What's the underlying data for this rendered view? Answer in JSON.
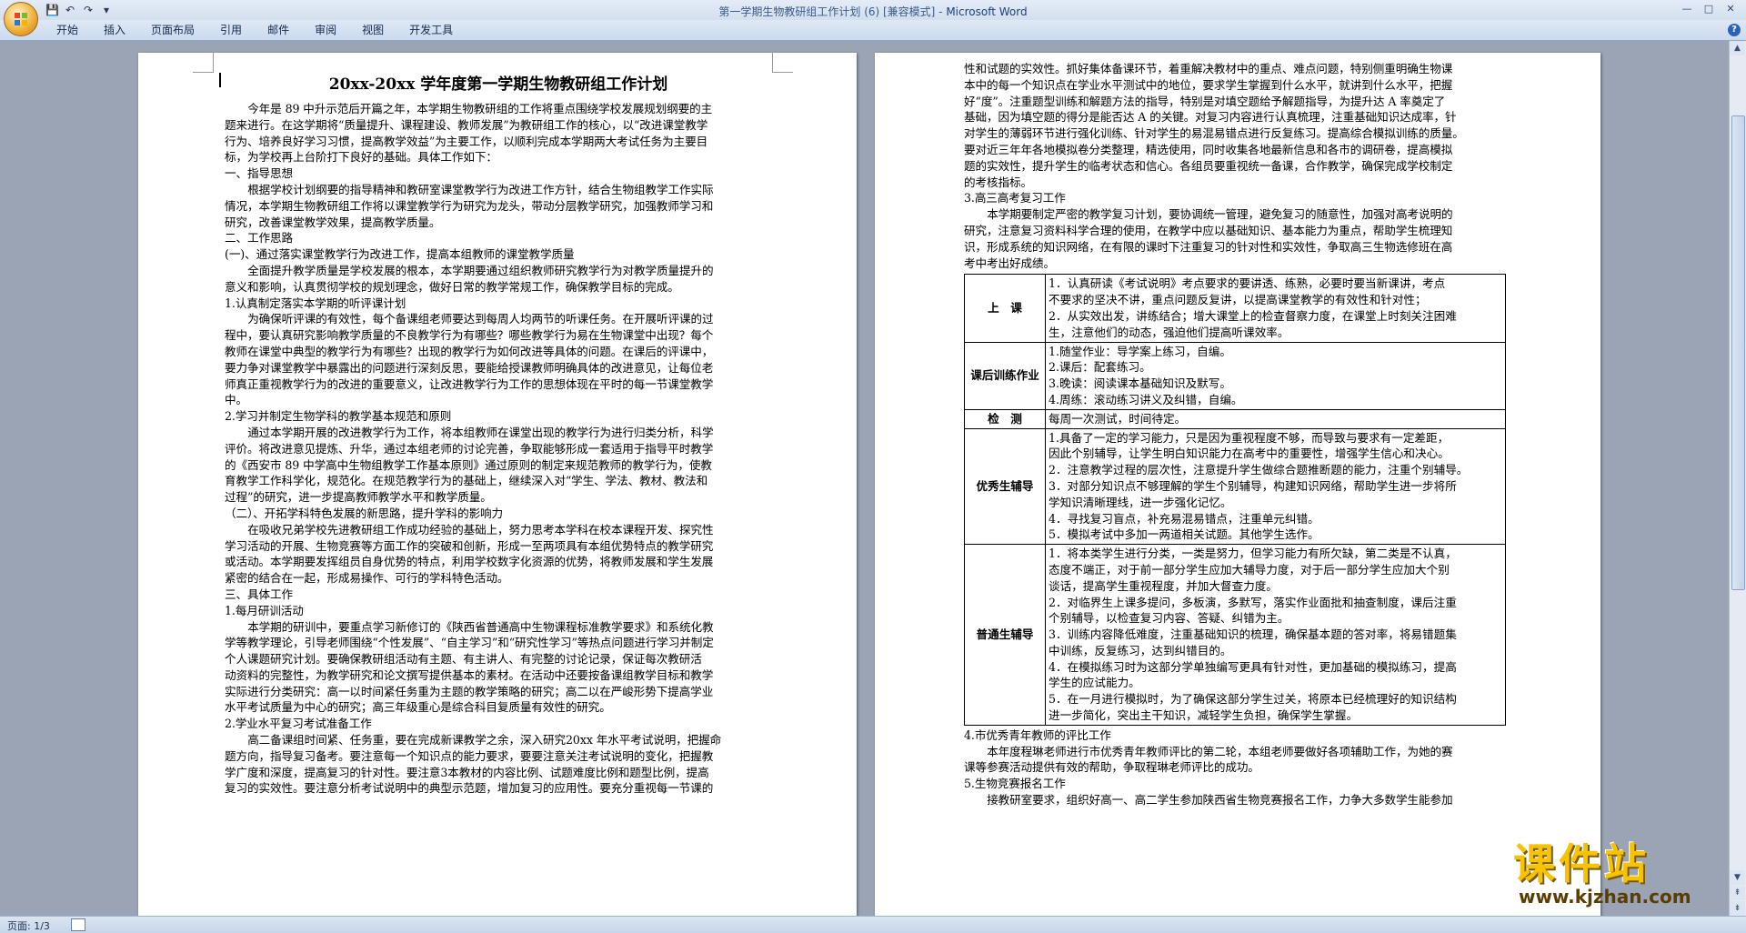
{
  "window": {
    "title": "第一学期生物教研组工作计划 (6) [兼容模式] - ",
    "app_name": "Microsoft Word",
    "controls": [
      "—",
      "□",
      "✕"
    ]
  },
  "quick_access": {
    "save": "💾",
    "undo": "↶",
    "redo": "↷",
    "more": "▾"
  },
  "ribbon": {
    "tabs": [
      "开始",
      "插入",
      "页面布局",
      "引用",
      "邮件",
      "审阅",
      "视图",
      "开发工具"
    ],
    "help": "?"
  },
  "status": {
    "page_indicator": "页面: 1/3"
  },
  "watermark": {
    "text": "课件站",
    "url": "www.kjzhan.com"
  },
  "page1": {
    "title": "20xx-20xx 学年度第一学期生物教研组工作计划",
    "lines": [
      "今年是 89 中升示范后开篇之年，本学期生物教研组的工作将重点围绕学校发展规划纲要的主",
      "题来进行。在这学期将“质量提升、课程建设、教师发展”为教研组工作的核心，以“改进课堂教学",
      "行为、培养良好学习习惯，提高教学效益”为主要工作，以顺利完成本学期两大考试任务为主要目",
      "标，为学校再上台阶打下良好的基础。具体工作如下：",
      "一、指导思想",
      "根据学校计划纲要的指导精神和教研室课堂教学行为改进工作方针，结合生物组教学工作实际",
      "情况，本学期生物教研组工作将以课堂教学行为研究为龙头，带动分层教学研究，加强教师学习和",
      "研究，改善课堂教学效果，提高教学质量。",
      "二、工作思路",
      "(一)、通过落实课堂教学行为改进工作，提高本组教师的课堂教学质量",
      "全面提升教学质量是学校发展的根本，本学期要通过组织教师研究教学行为对教学质量提升的",
      "意义和影响，认真贯彻学校的规划理念，做好日常的教学常规工作，确保教学目标的完成。",
      "1.认真制定落实本学期的听评课计划",
      "为确保听评课的有效性，每个备课组老师要达到每周人均两节的听课任务。在开展听评课的过",
      "程中，要认真研究影响教学质量的不良教学行为有哪些？哪些教学行为易在生物课堂中出现？每个",
      "教师在课堂中典型的教学行为有哪些？出现的教学行为如何改进等具体的问题。在课后的评课中，",
      "要力争对课堂教学中暴露出的问题进行深刻反思，要能给授课教师明确具体的改进意见，让每位老",
      "师真正重视教学行为的改进的重要意义，让改进教学行为工作的思想体现在平时的每一节课堂教学",
      "中。",
      "2.学习并制定生物学科的教学基本规范和原则",
      "通过本学期开展的改进教学行为工作，将本组教师在课堂出现的教学行为进行归类分析，科学",
      "评价。将改进意见提炼、升华，通过本组老师的讨论完善，争取能够形成一套适用于指导平时教学",
      "的《西安市 89 中学高中生物组教学工作基本原则》通过原则的制定来规范教师的教学行为，使教",
      "育教学工作科学化，规范化。在规范教学行为的基础上，继续深入对“学生、学法、教材、教法和",
      "过程”的研究，进一步提高教师教学水平和教学质量。",
      "（二）、开拓学科特色发展的新思路，提升学科的影响力",
      "在吸收兄弟学校先进教研组工作成功经验的基础上，努力思考本学科在校本课程开发、探究性",
      "学习活动的开展、生物竞赛等方面工作的突破和创新，形成一至两项具有本组优势特点的教学研究",
      "或活动。本学期要发挥组员自身优势的特点，利用学校数字化资源的优势，将教师发展和学生发展",
      "紧密的结合在一起，形成易操作、可行的学科特色活动。",
      "三、具体工作",
      "1.每月研训活动",
      "本学期的研训中，要重点学习新修订的《陕西省普通高中生物课程标准教学要求》和系统化教",
      "学等教学理论，引导老师围绕“个性发展”、“自主学习”和“研究性学习”等热点问题进行学习并制定",
      "个人课题研究计划。要确保教研组活动有主题、有主讲人、有完整的讨论记录，保证每次教研活",
      "动资料的完整性，为教学研究和论文撰写提供基本的素材。在活动中还要按备课组教学目标和教学",
      "实际进行分类研究：高一以时间紧任务重为主题的教学策略的研究；高二以在严峻形势下提高学业",
      "水平考试质量为中心的研究；高三年级重心是综合科目复质量有效性的研究。",
      "2.学业水平复习考试准备工作",
      "高二备课组时间紧、任务重，要在完成新课教学之余，深入研究20xx 年水平考试说明，把握命",
      "题方向，指导复习备考。要注意每一个知识点的能力要求，要要注意关注考试说明的变化，把握教",
      "学广度和深度，提高复习的针对性。要注意3本教材的内容比例、试题难度比例和题型比例，提高",
      "复习的实效性。要注意分析考试说明中的典型示范题，增加复习的应用性。要充分重视每一节课的"
    ]
  },
  "page2": {
    "lines_top": [
      "性和试题的实效性。抓好集体备课环节，着重解决教材中的重点、难点问题，特别侧重明确生物课",
      "本中的每一个知识点在学业水平测试中的地位，要求学生掌握到什么水平，就讲到什么水平，把握",
      "好“度”。注重题型训练和解题方法的指导，特别是对填空题给予解题指导，为提升达 A 率奠定了",
      "基础，因为填空题的得分是能否达 A 的关键。对复习内容进行认真梳理，注重基础知识达成率，针",
      "对学生的薄弱环节进行强化训练、针对学生的易混易错点进行反复练习。提高综合模拟训练的质量。",
      "要对近三年年各地模拟卷分类整理，精选使用，同时收集各地最新信息和各市的调研卷，提高模拟",
      "题的实效性，提升学生的临考状态和信心。各组员要重视统一备课，合作教学，确保完成学校制定",
      "的考核指标。",
      "3.高三高考复习工作",
      "本学期要制定严密的教学复习计划，要协调统一管理，避免复习的随意性，加强对高考说明的",
      "研究，注意复习资料科学合理的使用，在教学中应以基础知识、基本能力为重点，帮助学生梳理知",
      "识，形成系统的知识网络，在有限的课时下注重复习的针对性和实效性，争取高三生物选修班在高",
      "考中考出好成绩。"
    ],
    "table": [
      {
        "category": "上　课",
        "items": [
          "1．认真研读《考试说明》考点要求的要讲透、练熟，必要时要当新课讲，考点",
          "不要求的坚决不讲，重点问题反复讲，以提高课堂教学的有效性和针对性；",
          "2．从实效出发，讲练结合；增大课堂上的检查督察力度，在课堂上时刻关注困难",
          "生，注意他们的动态，强迫他们提高听课效率。"
        ]
      },
      {
        "category": "课后训练作业",
        "items": [
          "1.随堂作业：导学案上练习，自编。",
          "2.课后：配套练习。",
          "3.晚读：阅读课本基础知识及默写。",
          "4.周练：滚动练习讲义及纠错，自编。"
        ]
      },
      {
        "category": "检　测",
        "items": [
          "每周一次测试，时间待定。"
        ]
      },
      {
        "category": "优秀生辅导",
        "items": [
          "1.具备了一定的学习能力，只是因为重视程度不够，而导致与要求有一定差距，",
          "因此个别辅导，让学生明白知识能力在高考中的重要性，增强学生信心和决心。",
          "2．注意教学过程的层次性，注意提升学生做综合题推断题的能力，注重个别辅导。",
          "3．对部分知识点不够理解的学生个别辅导，构建知识网络，帮助学生进一步将所",
          "学知识清晰理线，进一步强化记忆。",
          "4．寻找复习盲点，补充易混易错点，注重单元纠错。",
          "5．模拟考试中多加一两道相关试题。其他学生选作。"
        ]
      },
      {
        "category": "普通生辅导",
        "items": [
          "1．将本类学生进行分类，一类是努力，但学习能力有所欠缺，第二类是不认真，",
          "态度不端正，对于前一部分学生应加大辅导力度，对于后一部分学生应加大个别",
          "谈话，提高学生重视程度，并加大督查力度。",
          "2．对临界生上课多提问，多板演，多默写，落实作业面批和抽查制度，课后注重",
          "个别辅导，以检查复习内容、答疑、纠错为主。",
          "3．训练内容降低难度，注重基础知识的梳理，确保基本题的答对率，将易错题集",
          "中训练，反复练习，达到纠错目的。",
          "4．在模拟练习时为这部分学单独编写更具有针对性，更加基础的模拟练习，提高",
          "学生的应试能力。",
          "5．在一月进行模拟时，为了确保这部分学生过关，将原本已经梳理好的知识结构",
          "进一步简化，突出主干知识，减轻学生负担，确保学生掌握。"
        ]
      }
    ],
    "lines_bottom": [
      "4.市优秀青年教师的评比工作",
      "本年度程琳老师进行市优秀青年教师评比的第二轮，本组老师要做好各项辅助工作，为她的赛",
      "课等参赛活动提供有效的帮助，争取程琳老师评比的成功。",
      "5.生物竞赛报名工作",
      "接教研室要求，组织好高一、高二学生参加陕西省生物竞赛报名工作，力争大多数学生能参加"
    ]
  }
}
